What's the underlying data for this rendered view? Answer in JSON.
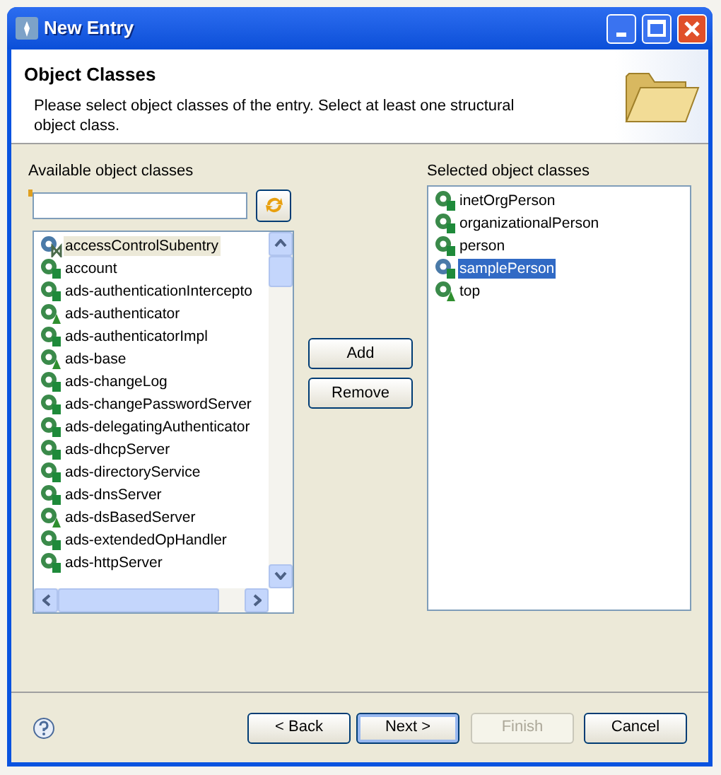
{
  "window": {
    "title": "New Entry"
  },
  "header": {
    "title": "Object Classes",
    "description": "Please select object classes of the entry. Select at least one structural object class."
  },
  "available": {
    "label": "Available object classes",
    "items": [
      {
        "label": "accessControlSubentry",
        "kind": "auxiliary",
        "selected": true
      },
      {
        "label": "account",
        "kind": "structural",
        "selected": false
      },
      {
        "label": "ads-authenticationIntercepto",
        "kind": "structural",
        "selected": false
      },
      {
        "label": "ads-authenticator",
        "kind": "abstract",
        "selected": false
      },
      {
        "label": "ads-authenticatorImpl",
        "kind": "structural",
        "selected": false
      },
      {
        "label": "ads-base",
        "kind": "abstract",
        "selected": false
      },
      {
        "label": "ads-changeLog",
        "kind": "structural",
        "selected": false
      },
      {
        "label": "ads-changePasswordServer",
        "kind": "structural",
        "selected": false
      },
      {
        "label": "ads-delegatingAuthenticator",
        "kind": "structural",
        "selected": false
      },
      {
        "label": "ads-dhcpServer",
        "kind": "structural",
        "selected": false
      },
      {
        "label": "ads-directoryService",
        "kind": "structural",
        "selected": false
      },
      {
        "label": "ads-dnsServer",
        "kind": "structural",
        "selected": false
      },
      {
        "label": "ads-dsBasedServer",
        "kind": "abstract",
        "selected": false
      },
      {
        "label": "ads-extendedOpHandler",
        "kind": "structural",
        "selected": false
      },
      {
        "label": "ads-httpServer",
        "kind": "structural",
        "selected": false
      }
    ]
  },
  "transfer_buttons": [
    {
      "label": "Add",
      "disabled": false
    },
    {
      "label": "Remove",
      "disabled": false
    }
  ],
  "selected_classes": {
    "label": "Selected object classes",
    "items": [
      {
        "label": "inetOrgPerson",
        "kind": "structural",
        "selected": false
      },
      {
        "label": "organizationalPerson",
        "kind": "structural",
        "selected": false
      },
      {
        "label": "person",
        "kind": "structural",
        "selected": false
      },
      {
        "label": "samplePerson",
        "kind": "structural",
        "selected": true
      },
      {
        "label": "top",
        "kind": "abstract",
        "selected": false
      }
    ]
  },
  "footer_buttons": [
    {
      "label": "< Back",
      "disabled": false,
      "default": false
    },
    {
      "label": "Next >",
      "disabled": false,
      "default": true
    },
    {
      "label": "Finish",
      "disabled": true,
      "default": false
    },
    {
      "label": "Cancel",
      "disabled": false,
      "default": false
    }
  ]
}
